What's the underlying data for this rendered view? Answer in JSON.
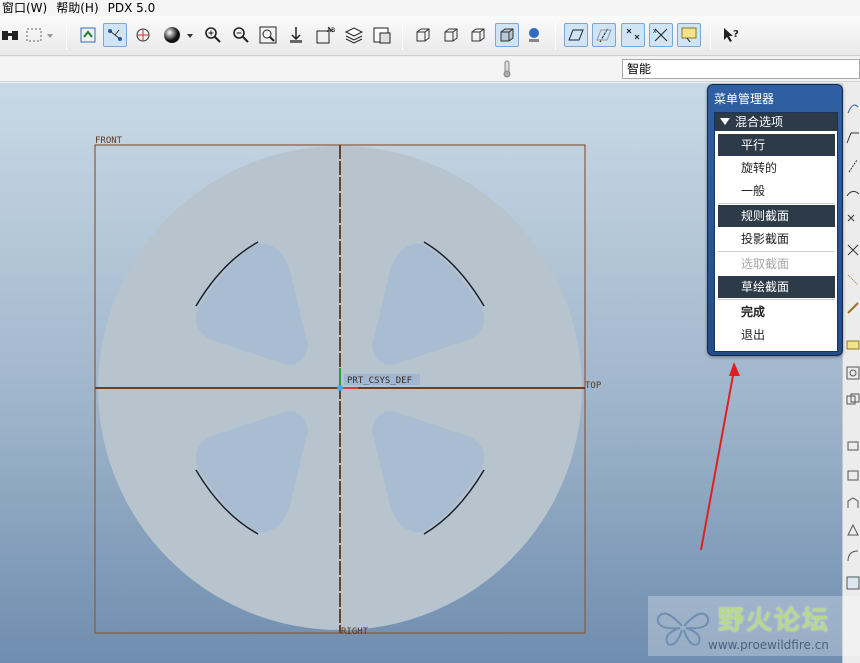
{
  "menubar": {
    "items": [
      "窗口(W)",
      "帮助(H)",
      "PDX 5.0"
    ]
  },
  "toolbar": {
    "icons": [
      "binoculars-icon",
      "select-box-icon",
      "dropdown-icon",
      "regenerate-icon",
      "datum-display-icon",
      "spin-center-icon",
      "shade-sphere-icon",
      "dropdown-icon",
      "zoom-in-icon",
      "zoom-out-icon",
      "refit-icon",
      "reorient-icon",
      "saved-views-icon",
      "layers-icon",
      "model-tree-icon",
      "wireframe-icon",
      "hidden-line-icon",
      "no-hidden-icon",
      "shading-icon",
      "appearance-icon",
      "datum-planes-icon",
      "datum-axes-icon",
      "datum-points-icon",
      "coord-systems-icon",
      "annotations-icon",
      "context-help-icon"
    ]
  },
  "filter": {
    "value": "智能"
  },
  "viewport": {
    "labels": {
      "front": "FRONT",
      "top": "TOP",
      "right": "RIGHT",
      "csys": "PRT_CSYS_DEF"
    }
  },
  "menu_manager": {
    "title": "菜单管理器",
    "header": "混合选项",
    "items": [
      {
        "label": "平行",
        "state": "selected"
      },
      {
        "label": "旋转的",
        "state": "normal"
      },
      {
        "label": "一般",
        "state": "normal"
      },
      {
        "label": "规则截面",
        "state": "selected"
      },
      {
        "label": "投影截面",
        "state": "normal"
      },
      {
        "label": "选取截面",
        "state": "disabled"
      },
      {
        "label": "草绘截面",
        "state": "selected"
      },
      {
        "label": "完成",
        "state": "bold"
      },
      {
        "label": "退出",
        "state": "normal"
      }
    ]
  },
  "watermark": {
    "text": "野火论坛",
    "url": "www.proewildfire.cn"
  },
  "colors": {
    "menu_blue": "#2f5fa3",
    "selected_dark": "#2d3a47",
    "datum_brown": "#8b5a3c",
    "part_gray": "#b6c2cc",
    "annotation_arrow": "#e02020"
  }
}
